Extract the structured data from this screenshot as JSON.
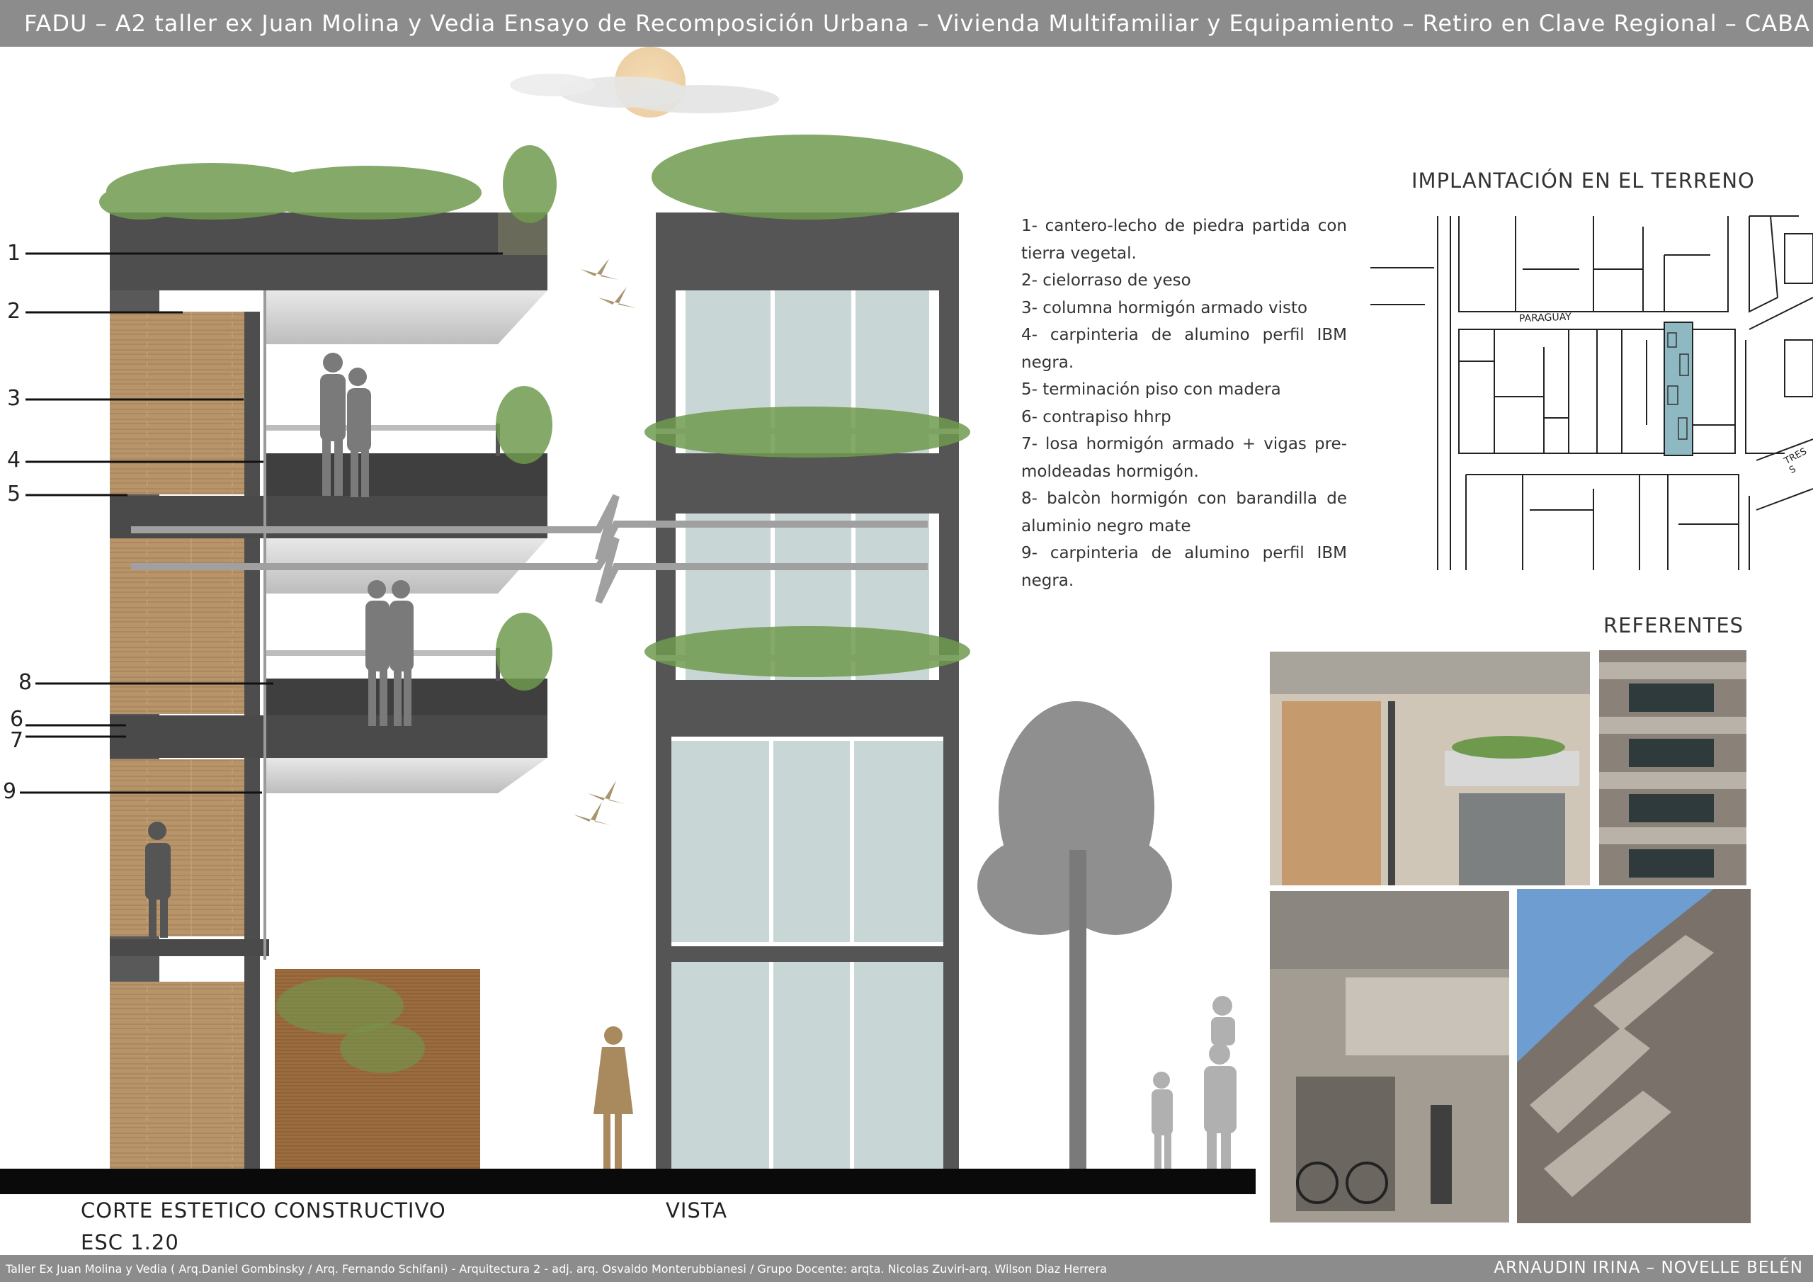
{
  "header": {
    "title": "FADU – A2  taller ex Juan Molina y Vedia Ensayo de Recomposición Urbana – Vivienda Multifamiliar y Equipamiento – Retiro en Clave Regional – CABA"
  },
  "footer": {
    "credits": "Taller Ex Juan Molina y Vedia ( Arq.Daniel Gombinsky / Arq. Fernando Schifani) - Arquitectura 2 - adj. arq. Osvaldo Monterubbianesi / Grupo Docente:  arqta. Nicolas Zuviri-arq. Wilson Diaz Herrera",
    "authors": "ARNAUDIN IRINA  – NOVELLE BELÉN"
  },
  "section_drawing": {
    "callouts": [
      "1",
      "2",
      "3",
      "4",
      "5",
      "6",
      "7",
      "8",
      "9"
    ],
    "caption": "CORTE ESTETICO CONSTRUCTIVO",
    "scale": "ESC 1.20"
  },
  "elevation": {
    "caption": "VISTA"
  },
  "legend": {
    "items": [
      "1- cantero-lecho de piedra partida con tierra vegetal.",
      "2- cielorraso de yeso",
      "3- columna hormigón armado visto",
      "4- carpinteria de alumino perfil IBM negra.",
      "5- terminación piso con madera",
      "6- contrapiso hhrp",
      "7- losa hormigón armado + vigas pre-moldeadas hormigón.",
      "8- balcòn hormigón con barandilla de aluminio negro mate",
      "9- carpinteria de alumino perfil IBM negra."
    ]
  },
  "site_plan": {
    "title": "IMPLANTACIÓN EN EL TERRENO",
    "street_labels": [
      "PARAGUAY",
      "TRES S"
    ]
  },
  "references": {
    "title": "REFERENTES"
  },
  "colors": {
    "bar_gray": "#8c8c8c",
    "concrete_dark": "#555555",
    "wood": "#b8946a",
    "glass": "#c9d6d6",
    "plant_green": "#6f9a4e",
    "ground": "#0a0a0a",
    "site_highlight": "#8fb9c2"
  }
}
